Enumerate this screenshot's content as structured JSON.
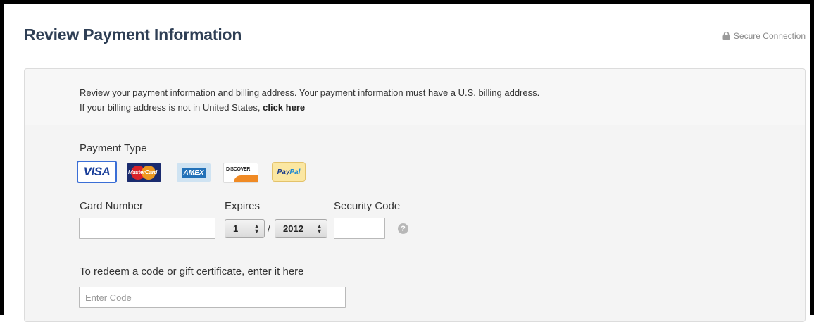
{
  "header": {
    "title": "Review Payment Information",
    "secure_label": "Secure Connection"
  },
  "notice": {
    "line1": "Review your payment information and billing address. Your payment information must have a U.S. billing address.",
    "line2_prefix": "If your billing address is not in United States, ",
    "line2_link": "click here"
  },
  "payment": {
    "label": "Payment Type",
    "types": [
      {
        "name": "VISA",
        "text": "VISA",
        "selected": true
      },
      {
        "name": "MasterCard",
        "text": "MasterCard"
      },
      {
        "name": "AMEX",
        "text": "AMEX"
      },
      {
        "name": "DISCOVER",
        "text": "DISCOVER"
      },
      {
        "name": "PayPal",
        "text_a": "Pay",
        "text_b": "Pal"
      }
    ]
  },
  "fields": {
    "card_number_label": "Card Number",
    "card_number_value": "",
    "expires_label": "Expires",
    "expires_month": "1",
    "expires_year": "2012",
    "expires_separator": "/",
    "security_code_label": "Security Code",
    "security_code_value": "",
    "help_glyph": "?"
  },
  "redeem": {
    "label": "To redeem a code or gift certificate, enter it here",
    "placeholder": "Enter Code",
    "value": ""
  },
  "colors": {
    "title": "#2f3f55",
    "selected_border": "#3a6ed6",
    "panel_bg": "#f4f4f4"
  }
}
